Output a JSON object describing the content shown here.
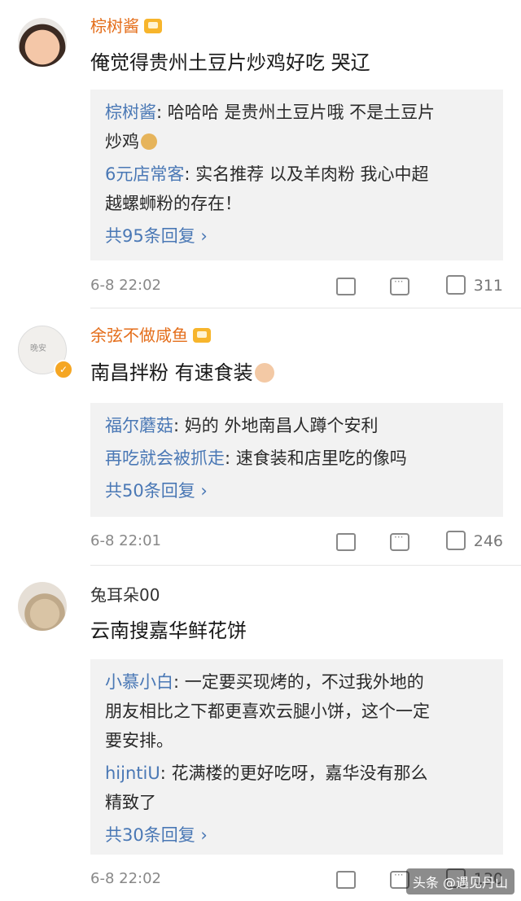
{
  "comments": [
    {
      "username": "棕树酱",
      "text": "俺觉得贵州土豆片炒鸡好吃 哭辽",
      "replies": [
        {
          "user": "棕树酱",
          "sep": ": ",
          "text_line1": "哈哈哈 是贵州土豆片哦 不是土豆片",
          "text_line2": "炒鸡"
        },
        {
          "user": "6元店常客",
          "sep": ": ",
          "text_line1": "实名推荐 以及羊肉粉 我心中超",
          "text_line2": "越螺蛳粉的存在！"
        }
      ],
      "more_replies": "共95条回复 ›",
      "time": "6-8 22:02",
      "likes": "311"
    },
    {
      "username": "余弦不做咸鱼",
      "avatar_text": "晚安",
      "text": "南昌拌粉 有速食装",
      "replies": [
        {
          "user": "福尔蘑菇",
          "sep": ": ",
          "text_line1": "妈的 外地南昌人蹲个安利"
        },
        {
          "user": "再吃就会被抓走",
          "sep": ": ",
          "text_line1": "速食装和店里吃的像吗"
        }
      ],
      "more_replies": "共50条回复 ›",
      "time": "6-8 22:01",
      "likes": "246"
    },
    {
      "username": "兔耳朵00",
      "text": "云南搜嘉华鲜花饼",
      "replies": [
        {
          "user": "小慕小白",
          "sep": ": ",
          "text_line1": "一定要买现烤的，不过我外地的",
          "text_line2": "朋友相比之下都更喜欢云腿小饼，这个一定",
          "text_line3": "要安排。"
        },
        {
          "user": "hijntiU",
          "sep": ": ",
          "text_line1": "花满楼的更好吃呀，嘉华没有那么",
          "text_line2": "精致了"
        }
      ],
      "more_replies": "共30条回复 ›",
      "time": "6-8 22:02",
      "likes": "130"
    }
  ],
  "watermark": "头条 @遇见丹山",
  "colors": {
    "username": "#e46e1b",
    "reply_user": "#4a78b5",
    "reply_bg": "#f2f2f2",
    "meta": "#888888"
  }
}
